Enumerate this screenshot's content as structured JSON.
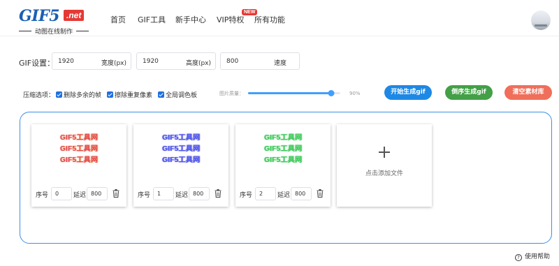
{
  "logo": {
    "main": "GIF5",
    "net": ".net",
    "subtitle": "动图在线制作"
  },
  "nav": {
    "items": [
      "首页",
      "GIF工具",
      "新手中心",
      "VIP特权",
      "所有功能"
    ],
    "badge": "NEW"
  },
  "settings": {
    "label": "GIF设置：",
    "width": {
      "value": "1920",
      "unit": "宽度(px)"
    },
    "height": {
      "value": "1920",
      "unit": "高度(px)"
    },
    "speed": {
      "value": "800",
      "unit": "速度"
    }
  },
  "options": {
    "label": "压缩选项：",
    "checkboxes": [
      {
        "label": "删除多余的帧",
        "checked": true
      },
      {
        "label": "擦除重复像素",
        "checked": true
      },
      {
        "label": "全局调色板",
        "checked": true
      }
    ],
    "quality_label": "图片质量：",
    "quality_value": "90%",
    "quality_fraction": 0.9
  },
  "actions": {
    "generate": "开始生成gif",
    "reverse": "倒序生成gif",
    "clear": "清空素材库"
  },
  "frames": [
    {
      "text": [
        "GIF5工具网",
        "GIF5工具网",
        "GIF5工具网"
      ],
      "order_label": "序号",
      "order": "0",
      "delay_label": "延迟",
      "delay": "800",
      "color": "#e0464a"
    },
    {
      "text": [
        "GIF5工具网",
        "GIF5工具网",
        "GIF5工具网"
      ],
      "order_label": "序号",
      "order": "1",
      "delay_label": "延迟",
      "delay": "800",
      "color": "#4a54e8"
    },
    {
      "text": [
        "GIF5工具网",
        "GIF5工具网",
        "GIF5工具网"
      ],
      "order_label": "序号",
      "order": "2",
      "delay_label": "延迟",
      "delay": "800",
      "color": "#3cc85a"
    }
  ],
  "add_file": "点击添加文件",
  "help": "使用帮助",
  "colors": {
    "accent": "#1e88e5",
    "green": "#43a047",
    "red": "#ef6f5a",
    "border": "#3c8ee6"
  }
}
